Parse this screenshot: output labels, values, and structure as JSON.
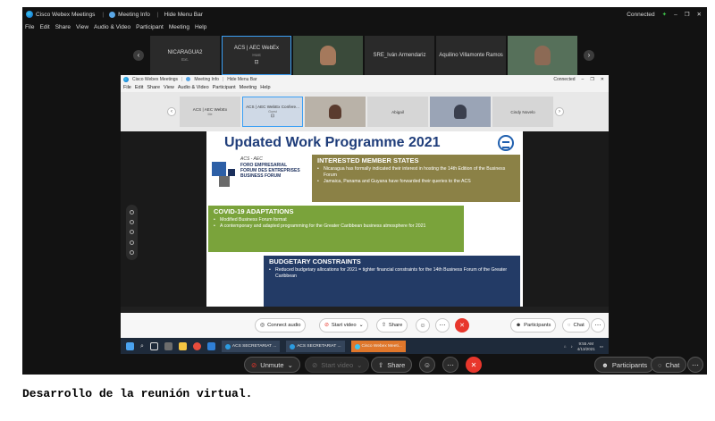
{
  "outer": {
    "title": {
      "app": "Cisco Webex Meetings",
      "info": "Meeting Info",
      "hide": "Hide Menu Bar",
      "status": "Connected"
    },
    "menu": [
      "File",
      "Edit",
      "Share",
      "View",
      "Audio & Video",
      "Participant",
      "Meeting",
      "Help"
    ],
    "tiles": [
      {
        "name": "NICARAGUA2",
        "sub": "Ext."
      },
      {
        "name": "ACS | AEC WebEx",
        "sub": "Host"
      },
      {
        "name": "",
        "sub": ""
      },
      {
        "name": "SRE_Iván Armendariz",
        "sub": ""
      },
      {
        "name": "Aquilino Villamonte Ramos",
        "sub": ""
      },
      {
        "name": "",
        "sub": ""
      }
    ],
    "controls": {
      "unmute": "Unmute",
      "start_video": "Start video",
      "share": "Share",
      "participants": "Participants",
      "chat": "Chat"
    }
  },
  "inner": {
    "title": {
      "app": "Cisco Webex Meetings",
      "info": "Meeting Info",
      "hide": "Hide Menu Bar",
      "status": "Connected"
    },
    "menu": [
      "File",
      "Edit",
      "Share",
      "View",
      "Audio & Video",
      "Participant",
      "Meeting",
      "Help"
    ],
    "tiles": [
      {
        "name": "ACS | AEC WebEx",
        "sub": "Me"
      },
      {
        "name": "ACS | AEC WebEx Confere...",
        "sub": "Guest"
      },
      {
        "name": "",
        "sub": ""
      },
      {
        "name": "Abigail",
        "sub": ""
      },
      {
        "name": "",
        "sub": ""
      },
      {
        "name": "Cindy Novelo",
        "sub": ""
      }
    ],
    "controls": {
      "connect_audio": "Connect audio",
      "start_video": "Start video",
      "share": "Share",
      "participants": "Participants",
      "chat": "Chat"
    },
    "taskbar": {
      "buttons": [
        "ACS SECRETARIAT ...",
        "ACS SECRETARIAT ...",
        "Cisco Webex Meeti..."
      ],
      "time": "9:55 AM",
      "date": "4/13/2021"
    }
  },
  "slide": {
    "title": "Updated Work Programme 2021",
    "logo": {
      "line1": "ACS - AEC",
      "line2": "FORO EMPRESARIAL",
      "line3": "FORUM DES ENTREPRISES",
      "line4": "BUSINESS FORUM"
    },
    "interested": {
      "heading": "INTERESTED MEMBER STATES",
      "items": [
        "Nicaragua has formally indicated their interest in hosting the 14th Edition of the Business Forum",
        "Jamaica, Panama and Guyana have forwarded their queries to the ACS"
      ]
    },
    "covid": {
      "heading": "COVID-19 ADAPTATIONS",
      "items": [
        "Modified Business Forum format",
        "A contemporary and adapted programming for the Greater Caribbean business atmosphere for 2021"
      ]
    },
    "budget": {
      "heading": "BUDGETARY CONSTRAINTS",
      "items": [
        "Reduced budgetary allocations for 2021 = tighter financial constraints for the 14th Business Forum of the Greater Caribbean"
      ]
    }
  },
  "caption": "Desarrollo de la reunión virtual.",
  "colors": {
    "accent": "#3a9ff5",
    "leave": "#e8372c",
    "slide_title": "#1f3d7a",
    "box_interest": "#8b8146",
    "box_covid": "#7aa33b",
    "box_budget": "#233b66"
  }
}
